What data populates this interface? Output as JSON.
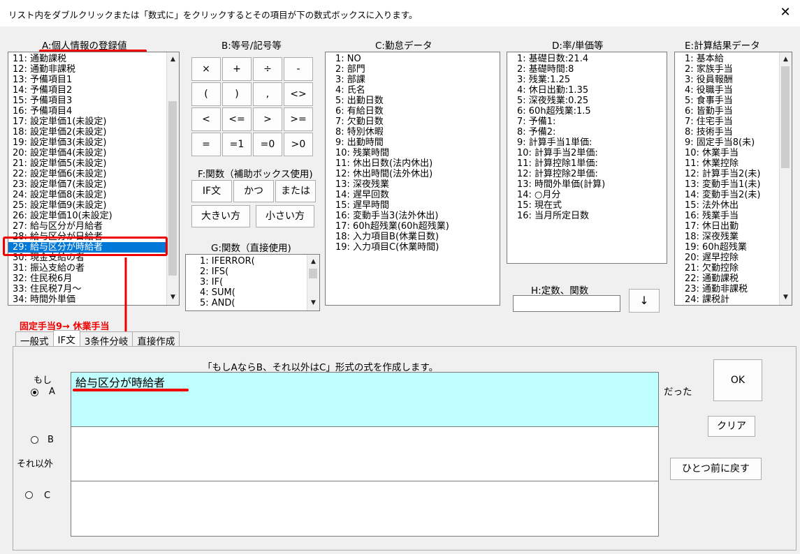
{
  "window": {
    "title": "リスト内をダブルクリックまたは「数式に」をクリックするとその項目が下の数式ボックスに入ります。",
    "close": "✕"
  },
  "colA": {
    "header": "A:個人情報の登録値",
    "items": [
      "11: 通勤課税",
      "12: 通勤非課税",
      "13: 予備項目1",
      "14: 予備項目2",
      "15: 予備項目3",
      "16: 予備項目4",
      "17: 設定単価1(未設定)",
      "18: 設定単価2(未設定)",
      "19: 設定単価3(未設定)",
      "20: 設定単価4(未設定)",
      "21: 設定単価5(未設定)",
      "22: 設定単価6(未設定)",
      "23: 設定単価7(未設定)",
      "24: 設定単価8(未設定)",
      "25: 設定単価9(未設定)",
      "26: 設定単価10(未設定)",
      "27: 給与区分が月給者",
      "28: 給与区分が日給者",
      "29: 給与区分が時給者",
      "30: 現金支給の者",
      "31: 振込支給の者",
      "32: 住民税6月",
      "33: 住民税7月～",
      "34: 時間外単価"
    ],
    "selected": "29: 給与区分が時給者"
  },
  "colB": {
    "header": "B:等号/記号等",
    "buttons": [
      "×",
      "+",
      "÷",
      "-",
      "(",
      ")",
      ",",
      "<>",
      "<",
      "<=",
      ">",
      ">=",
      "=",
      "=1",
      "=0",
      ">0"
    ]
  },
  "colF": {
    "header": "F:関数（補助ボックス使用)",
    "buttons_row1": [
      "IF文",
      "かつ",
      "または"
    ],
    "buttons_row2": [
      "大きい方",
      "小さい方"
    ]
  },
  "colG": {
    "header": "G:関数（直接使用)",
    "items": [
      "1: IFERROR(",
      "2: IFS(",
      "3: IF(",
      "4: SUM(",
      "5: AND("
    ]
  },
  "colC": {
    "header": "C:勤怠データ",
    "items": [
      "1: NO",
      "2: 部門",
      "3: 部課",
      "4: 氏名",
      "5: 出勤日数",
      "6: 有給日数",
      "7: 欠勤日数",
      "8: 特別休暇",
      "9: 出勤時間",
      "10: 残業時間",
      "11: 休出日数(法内休出)",
      "12: 休出時間(法外休出)",
      "13: 深夜残業",
      "14: 遅早回数",
      "15: 遅早時間",
      "16: 変動手当3(法外休出)",
      "17: 60h超残業(60h超残業)",
      "18: 入力項目B(休業日数)",
      "19: 入力項目C(休業時間)"
    ]
  },
  "colD": {
    "header": "D:率/単価等",
    "items": [
      "1: 基礎日数:21.4",
      "2: 基礎時間:8",
      "3: 残業:1.25",
      "4: 休日出勤:1.35",
      "5: 深夜残業:0.25",
      "6: 60h超残業:1.5",
      "7: 予備1:",
      "8: 予備2:",
      "9: 計算手当1単価:",
      "10: 計算手当2単価:",
      "11: 計算控除1単価:",
      "12: 計算控除2単価:",
      "13: 時間外単価(計算)",
      "14: ○月分",
      "15: 現在式",
      "16: 当月所定日数"
    ]
  },
  "colH": {
    "header": "H:定数、関数",
    "value": "",
    "arrow": "↓"
  },
  "colE": {
    "header": "E:計算結果データ",
    "items": [
      "1: 基本給",
      "2: 家族手当",
      "3: 役員報酬",
      "4: 役職手当",
      "5: 食事手当",
      "6: 皆勤手当",
      "7: 住宅手当",
      "8: 技術手当",
      "9: 固定手当8(未)",
      "10: 休業手当",
      "11: 休業控除",
      "12: 計算手当2(未)",
      "13: 変動手当1(未)",
      "14: 変動手当2(未)",
      "15: 法外休出",
      "16: 残業手当",
      "17: 休日出勤",
      "18: 深夜残業",
      "19: 60h超残業",
      "20: 遅早控除",
      "21: 欠勤控除",
      "22: 通勤課税",
      "23: 通勤非課税",
      "24: 課税計"
    ]
  },
  "annotation": "固定手当9→ 休業手当",
  "tabs": [
    "一般式",
    "IF文",
    "3条件分岐",
    "直接作成"
  ],
  "activeTab": "IF文",
  "ifPanel": {
    "instruction": "「もしAならB、それ以外はC」形式の式を作成します。",
    "moshi": "もし",
    "labelA": "A",
    "labelB": "B",
    "labelC": "C",
    "soreigai": "それ以外",
    "datta": "だった",
    "boxA": "給与区分が時給者",
    "boxB": "",
    "boxC": "",
    "ok": "OK",
    "clear": "クリア",
    "back": "ひとつ前に戻す"
  },
  "colors": {
    "selection": "#0078d7",
    "highlight": "#e00000",
    "boxA": "#c0ffff"
  }
}
